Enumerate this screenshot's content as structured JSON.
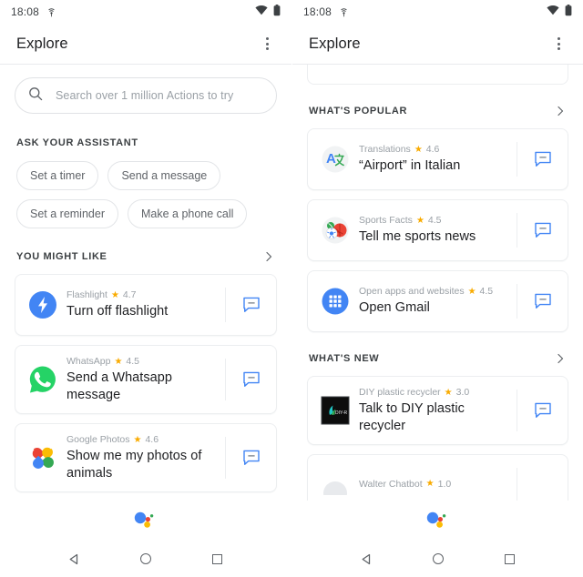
{
  "screens": [
    {
      "id": "left",
      "status_bar": {
        "time": "18:08",
        "cast_icon": "cast-icon",
        "wifi_icon": "wifi-icon",
        "battery_icon": "battery-icon"
      },
      "app_bar": {
        "title": "Explore",
        "menu_icon": "overflow-menu-icon"
      },
      "search": {
        "placeholder": "Search over 1 million Actions to try",
        "icon": "search-icon"
      },
      "sections": [
        {
          "label": "ASK YOUR ASSISTANT",
          "has_chevron": false,
          "chips": [
            "Set a timer",
            "Send a message",
            "Set a reminder",
            "Make a phone call"
          ]
        },
        {
          "label": "YOU MIGHT LIKE",
          "has_chevron": true,
          "cards": [
            {
              "app": "Flashlight",
              "star": "★",
              "rating": "4.7",
              "query": "Turn off flashlight",
              "icon": "flashlight-icon",
              "action_icon": "chat-bubble-icon"
            },
            {
              "app": "WhatsApp",
              "star": "★",
              "rating": "4.5",
              "query": "Send a Whatsapp message",
              "icon": "whatsapp-icon",
              "action_icon": "chat-bubble-icon"
            },
            {
              "app": "Google Photos",
              "star": "★",
              "rating": "4.6",
              "query": "Show me my photos of animals",
              "icon": "google-photos-icon",
              "action_icon": "chat-bubble-icon"
            }
          ]
        }
      ],
      "assistant_logo": "google-assistant-dots",
      "nav_bar": {
        "back": "back-button",
        "home": "home-button",
        "recents": "recents-button"
      }
    },
    {
      "id": "right",
      "status_bar": {
        "time": "18:08",
        "cast_icon": "cast-icon",
        "wifi_icon": "wifi-icon",
        "battery_icon": "battery-icon"
      },
      "app_bar": {
        "title": "Explore",
        "menu_icon": "overflow-menu-icon"
      },
      "sections": [
        {
          "label": "WHAT'S POPULAR",
          "has_chevron": true,
          "cards": [
            {
              "app": "Translations",
              "star": "★",
              "rating": "4.6",
              "query": "“Airport” in Italian",
              "icon": "google-translate-icon",
              "action_icon": "chat-bubble-icon"
            },
            {
              "app": "Sports Facts",
              "star": "★",
              "rating": "4.5",
              "query": "Tell me sports news",
              "icon": "sports-balls-icon",
              "action_icon": "chat-bubble-icon"
            },
            {
              "app": "Open apps and websites",
              "star": "★",
              "rating": "4.5",
              "query": "Open Gmail",
              "icon": "apps-grid-icon",
              "action_icon": "chat-bubble-icon"
            }
          ]
        },
        {
          "label": "WHAT'S NEW",
          "has_chevron": true,
          "cards": [
            {
              "app": "DIY plastic recycler",
              "star": "★",
              "rating": "3.0",
              "query": "Talk to DIY plastic recycler",
              "icon": "diy-recycler-icon",
              "action_icon": "chat-bubble-icon"
            },
            {
              "app": "Walter Chatbot",
              "star": "★",
              "rating": "1.0",
              "query": "",
              "icon": "walter-chatbot-icon",
              "action_icon": "chat-bubble-icon"
            }
          ]
        }
      ],
      "assistant_logo": "google-assistant-dots",
      "nav_bar": {
        "back": "back-button",
        "home": "home-button",
        "recents": "recents-button"
      }
    }
  ],
  "colors": {
    "accent_blue": "#4285F4",
    "star_amber": "#F9AB00",
    "text_primary": "#202124",
    "text_secondary": "#9AA0A6",
    "card_border": "#ECEEF0"
  }
}
